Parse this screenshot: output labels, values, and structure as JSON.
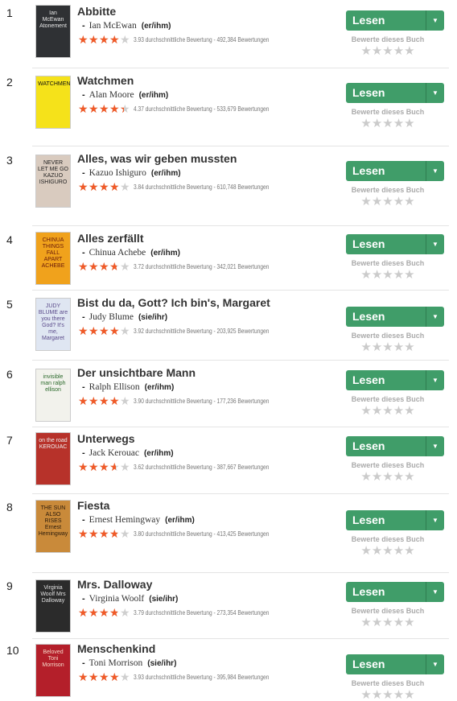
{
  "read_button_label": "Lesen",
  "rate_label": "Bewerte dieses Buch",
  "books": [
    {
      "rank": "1",
      "title": "Abbitte",
      "author": "Ian McEwan",
      "pronoun": "(er/ihm)",
      "rating": 3.93,
      "rating_text": "3.93 durchschnittliche Bewertung - 492,384 Bewertungen",
      "cover_text": "Ian McEwan Atonement",
      "cover_color": "#2f3134",
      "cover_text_color": "#e8e8e8"
    },
    {
      "rank": "2",
      "title": "Watchmen",
      "author": "Alan Moore",
      "pronoun": "(er/ihm)",
      "rating": 4.37,
      "rating_text": "4.37 durchschnittliche Bewertung - 533,679 Bewertungen",
      "cover_text": "WATCHMEN",
      "cover_color": "#f5e21a",
      "cover_text_color": "#111111"
    },
    {
      "rank": "3",
      "title": "Alles, was wir geben mussten",
      "author": "Kazuo Ishiguro",
      "pronoun": "(er/ihm)",
      "rating": 3.84,
      "rating_text": "3.84 durchschnittliche Bewertung - 610,748 Bewertungen",
      "cover_text": "NEVER LET ME GO KAZUO ISHIGURO",
      "cover_color": "#d9cbbf",
      "cover_text_color": "#222222"
    },
    {
      "rank": "4",
      "title": "Alles zerfällt",
      "author": "Chinua Achebe",
      "pronoun": "(er/ihm)",
      "rating": 3.72,
      "rating_text": "3.72 durchschnittliche Bewertung - 342,021 Bewertungen",
      "cover_text": "CHINUA THINGS FALL APART ACHEBE",
      "cover_color": "#f0a21c",
      "cover_text_color": "#6a1a0a"
    },
    {
      "rank": "5",
      "title": "Bist du da, Gott? Ich bin's, Margaret",
      "author": "Judy Blume",
      "pronoun": "(sie/ihr)",
      "rating": 3.92,
      "rating_text": "3.92 durchschnittliche Bewertung - 203,925 Bewertungen",
      "cover_text": "JUDY BLUME are you there God? It's me, Margaret",
      "cover_color": "#dfe6f2",
      "cover_text_color": "#5a4a8a"
    },
    {
      "rank": "6",
      "title": "Der unsichtbare Mann",
      "author": "Ralph Ellison",
      "pronoun": "(er/ihm)",
      "rating": 3.9,
      "rating_text": "3.90 durchschnittliche Bewertung - 177,236 Bewertungen",
      "cover_text": "invisible man ralph ellison",
      "cover_color": "#f2f2ec",
      "cover_text_color": "#2c6a2c"
    },
    {
      "rank": "7",
      "title": "Unterwegs",
      "author": "Jack Kerouac",
      "pronoun": "(er/ihm)",
      "rating": 3.62,
      "rating_text": "3.62 durchschnittliche Bewertung - 387,667 Bewertungen",
      "cover_text": "on the road KEROUAC",
      "cover_color": "#b7322a",
      "cover_text_color": "#f0f0f0"
    },
    {
      "rank": "8",
      "title": "Fiesta",
      "author": "Ernest Hemingway",
      "pronoun": "(er/ihm)",
      "rating": 3.8,
      "rating_text": "3.80 durchschnittliche Bewertung - 413,425 Bewertungen",
      "cover_text": "THE SUN ALSO RISES Ernest Hemingway",
      "cover_color": "#c98a3a",
      "cover_text_color": "#2a1a0a"
    },
    {
      "rank": "9",
      "title": "Mrs. Dalloway",
      "author": "Virginia Woolf",
      "pronoun": "(sie/ihr)",
      "rating": 3.79,
      "rating_text": "3.79 durchschnittliche Bewertung - 273,354 Bewertungen",
      "cover_text": "Virginia Woolf Mrs Dalloway",
      "cover_color": "#2b2b2b",
      "cover_text_color": "#e0e0e0"
    },
    {
      "rank": "10",
      "title": "Menschenkind",
      "author": "Toni Morrison",
      "pronoun": "(sie/ihr)",
      "rating": 3.93,
      "rating_text": "3.93 durchschnittliche Bewertung - 395,984 Bewertungen",
      "cover_text": "Beloved Toni Morrison",
      "cover_color": "#b41f2a",
      "cover_text_color": "#f5d8c8"
    }
  ]
}
